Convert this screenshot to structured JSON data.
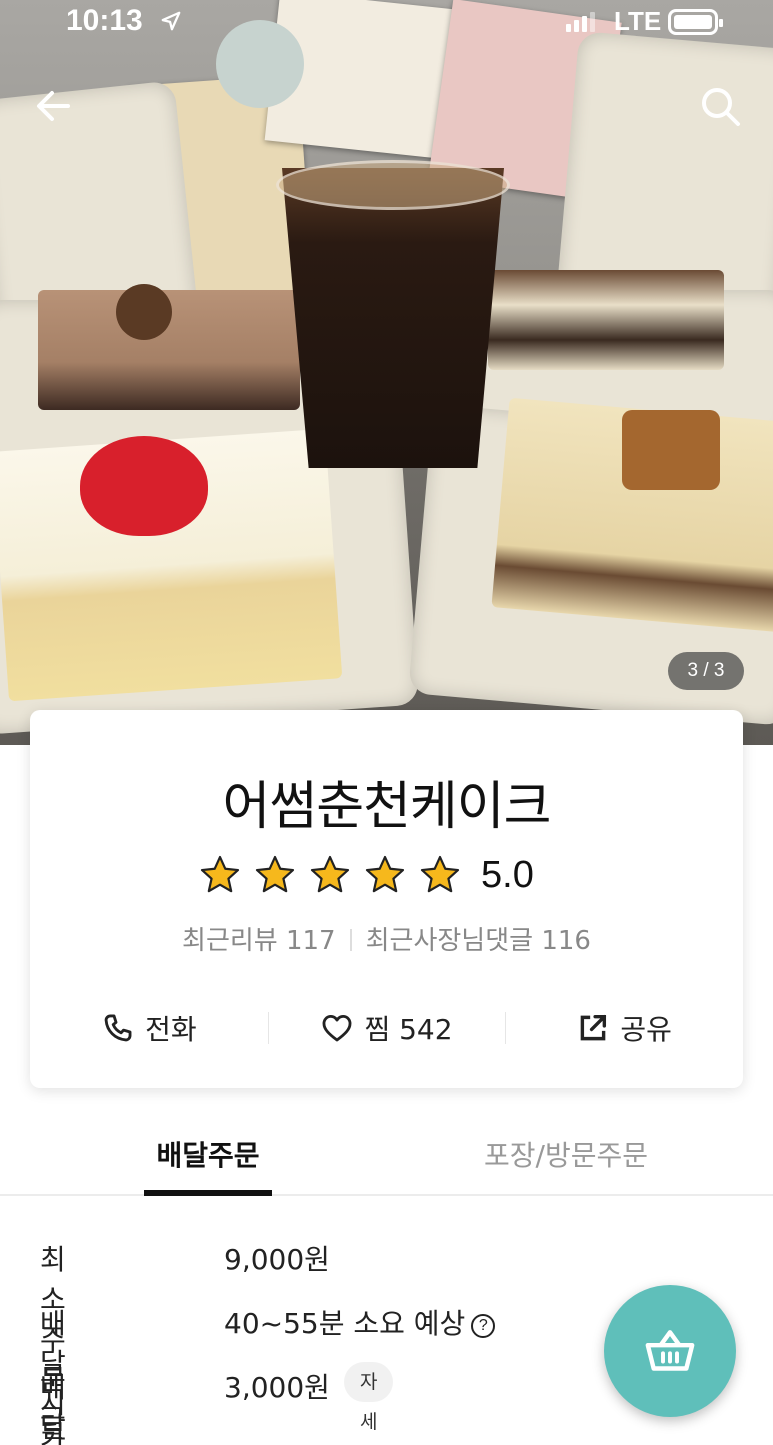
{
  "status_bar": {
    "time": "10:13",
    "network": "LTE"
  },
  "gallery": {
    "counter": "3 / 3"
  },
  "shop": {
    "name": "어썸춘천케이크",
    "rating": "5.0",
    "stars": 5,
    "recent_reviews": "최근리뷰 117",
    "owner_replies": "최근사장님댓글 116"
  },
  "actions": {
    "call_label": "전화",
    "like_label": "찜 542",
    "share_label": "공유"
  },
  "tabs": [
    {
      "label": "배달주문",
      "active": true
    },
    {
      "label": "포장/방문주문",
      "active": false
    }
  ],
  "delivery_info": {
    "min_order_label": "최소주문금액",
    "min_order_value": "9,000원",
    "time_label": "배달시간",
    "time_value": "40~55분 소요 예상",
    "tip_label": "배달팁",
    "tip_value": "3,000원",
    "tip_detail_label": "자세히"
  },
  "colors": {
    "accent": "#5fbfba",
    "star": "#f6b81c"
  },
  "icons": [
    "back-arrow-icon",
    "search-icon",
    "phone-icon",
    "heart-icon",
    "share-icon",
    "cart-icon",
    "help-icon"
  ]
}
